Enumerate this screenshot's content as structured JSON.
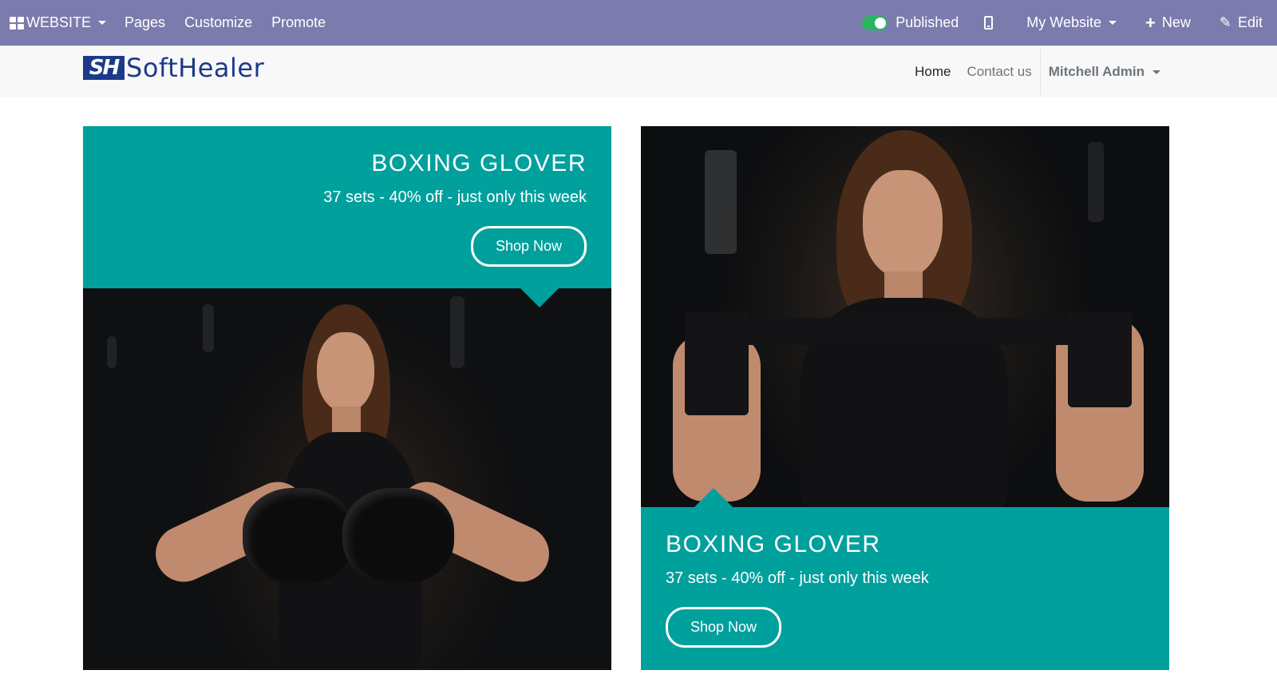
{
  "admin_bar": {
    "app_label": "WEBSITE",
    "menu": [
      "Pages",
      "Customize",
      "Promote"
    ],
    "published_label": "Published",
    "website_label": "My Website",
    "new_label": "New",
    "edit_label": "Edit",
    "background_color": "#7c7bad",
    "published_toggle_color": "#28b463"
  },
  "header": {
    "logo_mark": "SH",
    "logo_text": "SoftHealer",
    "nav": {
      "home": "Home",
      "contact": "Contact us",
      "user": "Mitchell Admin"
    }
  },
  "banners": [
    {
      "title": "BOXING GLOVER",
      "subtitle": "37 sets - 40% off - just only this week",
      "button": "Shop Now"
    },
    {
      "title": "BOXING GLOVER",
      "subtitle": "37 sets - 40% off - just only this week",
      "button": "Shop Now"
    }
  ],
  "colors": {
    "teal": "#00a09d",
    "logo_blue": "#1d3a8a"
  }
}
